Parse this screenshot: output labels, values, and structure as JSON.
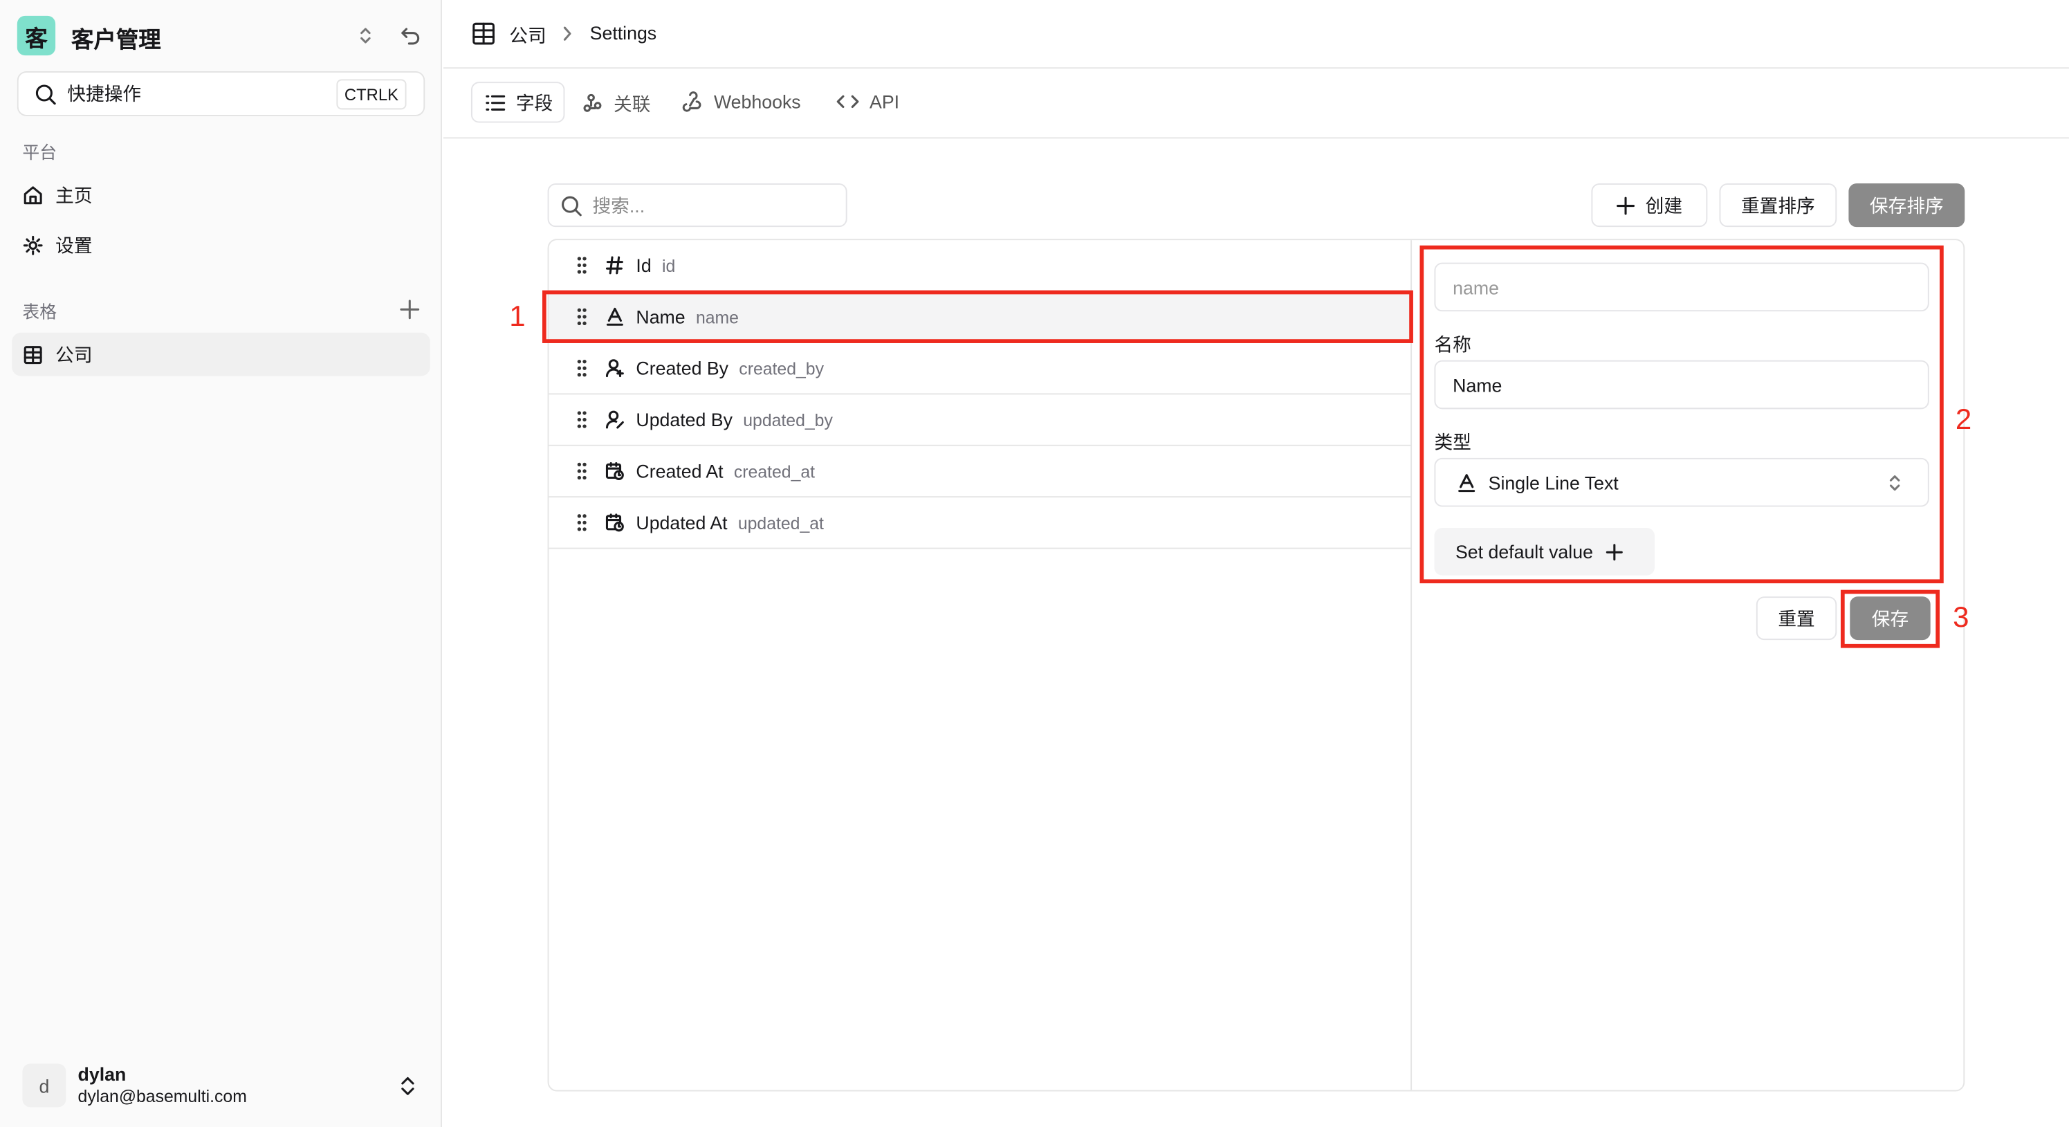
{
  "sidebar": {
    "logo_char": "客",
    "app_title": "客户管理",
    "quick_action": "快捷操作",
    "shortcut": "CTRLK",
    "section_platform": "平台",
    "nav": [
      {
        "label": "主页",
        "icon": "home-icon"
      },
      {
        "label": "设置",
        "icon": "gear-icon"
      }
    ],
    "section_tables": "表格",
    "tables": [
      {
        "label": "公司",
        "icon": "table-icon"
      }
    ],
    "user": {
      "avatar": "d",
      "name": "dylan",
      "email": "dylan@basemulti.com"
    }
  },
  "header": {
    "breadcrumb": [
      "公司",
      "Settings"
    ]
  },
  "tabs": [
    {
      "label": "字段",
      "active": true
    },
    {
      "label": "关联"
    },
    {
      "label": "Webhooks"
    },
    {
      "label": "API"
    }
  ],
  "toolbar": {
    "search_placeholder": "搜索...",
    "create": "创建",
    "reset_order": "重置排序",
    "save_order": "保存排序"
  },
  "fields": [
    {
      "name": "Id",
      "key": "id",
      "icon": "hash-icon"
    },
    {
      "name": "Name",
      "key": "name",
      "icon": "text-type-icon",
      "selected": true
    },
    {
      "name": "Created By",
      "key": "created_by",
      "icon": "user-plus-icon"
    },
    {
      "name": "Updated By",
      "key": "updated_by",
      "icon": "user-edit-icon"
    },
    {
      "name": "Created At",
      "key": "created_at",
      "icon": "calendar-clock-icon"
    },
    {
      "name": "Updated At",
      "key": "updated_at",
      "icon": "calendar-clock-icon"
    }
  ],
  "form": {
    "key_placeholder": "name",
    "name_label": "名称",
    "name_value": "Name",
    "type_label": "类型",
    "type_value": "Single Line Text",
    "default_value": "Set default value",
    "reset": "重置",
    "save": "保存"
  },
  "annotations": [
    "1",
    "2",
    "3"
  ],
  "colors": {
    "accent_logo": "#7fe0cc",
    "primary_button": "#8a8a8a",
    "annotation": "#ee2a1e"
  }
}
